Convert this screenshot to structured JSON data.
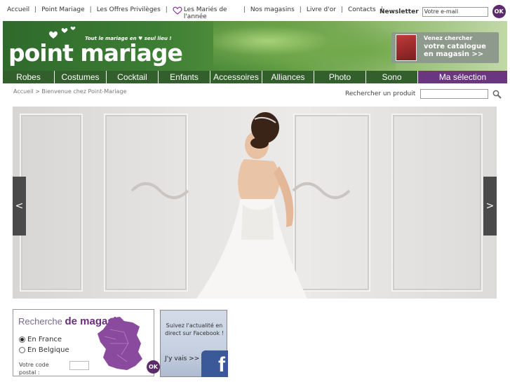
{
  "topnav": {
    "links": [
      "Accueil",
      "Point Mariage",
      "Les Offres Privilèges",
      "Les Mariés de l'année",
      "Nos magasins",
      "Livre d'or",
      "Contacts"
    ],
    "separator": "|",
    "newsletter_label": "Newsletter",
    "newsletter_placeholder": "Votre e-mail",
    "newsletter_ok": "OK"
  },
  "banner": {
    "tagline": "Tout le mariage en ♥ seul lieu !",
    "logo_text": "point mariage",
    "catalog_line1": "Venez chercher",
    "catalog_line2": "votre catalogue",
    "catalog_line3": "en magasin >>"
  },
  "menu": {
    "items": [
      "Robes",
      "Costumes",
      "Cocktail",
      "Enfants",
      "Accessoires",
      "Alliances",
      "Photo",
      "Sono",
      "Ma sélection"
    ]
  },
  "breadcrumb": {
    "home": "Accueil",
    "sep": ">",
    "current": "Bienvenue chez Point-Mariage"
  },
  "search": {
    "label": "Rechercher un produit",
    "value": ""
  },
  "hero": {
    "prev": "<",
    "next": ">"
  },
  "store_search": {
    "title_light": "Recherche",
    "title_bold": "de magasin",
    "option_france": "En France",
    "option_belgique": "En Belgique",
    "selected": "En France",
    "postal_label": "Votre code postal :",
    "postal_value": "",
    "ok": "OK"
  },
  "facebook": {
    "text": "Suivez l'actualité en direct sur Facebook !",
    "link": "J'y vais >>",
    "logo_letter": "f"
  },
  "colors": {
    "brand_purple": "#6a2e7c",
    "menu_green": "#335f2c",
    "facebook_blue": "#3b5998"
  }
}
